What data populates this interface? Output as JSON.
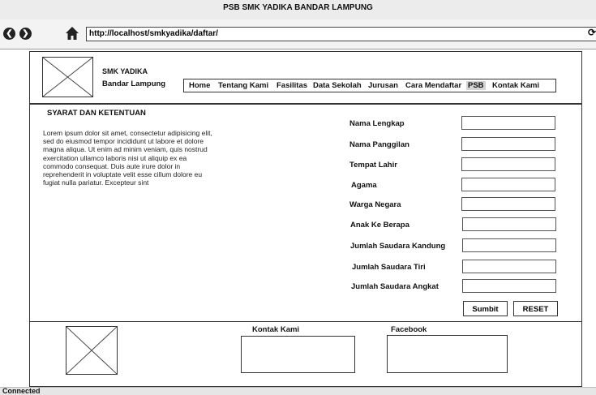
{
  "window": {
    "title": "PSB SMK YADIKA BANDAR LAMPUNG"
  },
  "toolbar": {
    "url": "http://localhost/smkyadika/daftar/"
  },
  "header": {
    "school_name": "SMK YADIKA",
    "city": "Bandar Lampung",
    "menu": [
      "Home",
      "Tentang Kami",
      "Fasilitas",
      "Data Sekolah",
      "Jurusan",
      "Cara Mendaftar",
      "PSB",
      "Kontak Kami"
    ],
    "active_menu": "PSB"
  },
  "main": {
    "section_title": "SYARAT DAN KETENTUAN",
    "body_text": "Lorem ipsum dolor sit amet, consectetur adipisicing elit, sed do eiusmod tempor incididunt ut labore et dolore magna aliqua. Ut enim ad minim veniam, quis nostrud exercitation ullamco laboris nisi ut aliquip ex ea commodo consequat. Duis aute irure dolor in reprehenderit in voluptate velit esse cillum dolore eu fugiat nulla pariatur. Excepteur sint"
  },
  "form": {
    "fields": [
      {
        "label": "Nama Lengkap",
        "value": ""
      },
      {
        "label": "Nama Panggilan",
        "value": ""
      },
      {
        "label": "Tempat Lahir",
        "value": ""
      },
      {
        "label": "Agama",
        "value": ""
      },
      {
        "label": "Warga Negara",
        "value": ""
      },
      {
        "label": "Anak Ke Berapa",
        "value": ""
      },
      {
        "label": "Jumlah Saudara Kandung",
        "value": ""
      },
      {
        "label": "Jumlah Saudara Tiri",
        "value": ""
      },
      {
        "label": "Jumlah Saudara Angkat",
        "value": ""
      }
    ],
    "submit_label": "Sumbit",
    "reset_label": "RESET"
  },
  "footer": {
    "contact_title": "Kontak Kami",
    "facebook_title": "Facebook"
  },
  "status": {
    "text": "Connected"
  },
  "icons": {
    "back": "back-arrow-icon",
    "forward": "forward-arrow-icon",
    "home": "home-icon",
    "logo": "logo-placeholder",
    "footer_image": "image-placeholder"
  }
}
